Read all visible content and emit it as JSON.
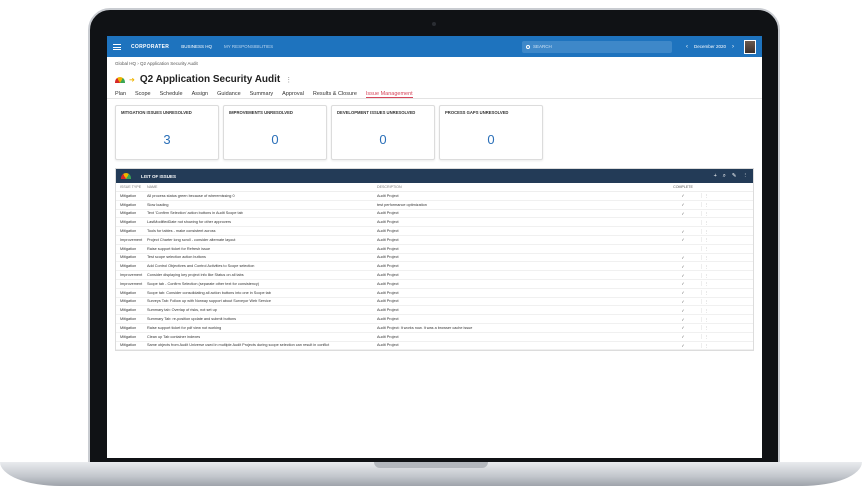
{
  "topbar": {
    "brand": "CORPORATER",
    "nav": [
      "BUSINESS HQ",
      "MY RESPONSIBILITIES"
    ],
    "search_placeholder": "SEARCH",
    "period": "December 2020"
  },
  "breadcrumb": "Global HQ  ›  Q2 Application Security Audit",
  "page_title": "Q2 Application Security Audit",
  "tabs": [
    "Plan",
    "Scope",
    "Schedule",
    "Assign",
    "Guidance",
    "Summary",
    "Approval",
    "Results & Closure",
    "Issue Management"
  ],
  "active_tab": "Issue Management",
  "cards": [
    {
      "label": "MITIGATION ISSUES UNRESOLVED",
      "value": "3"
    },
    {
      "label": "IMPROVEMENTS UNRESOLVED",
      "value": "0"
    },
    {
      "label": "DEVELOPMENT ISSUES UNRESOLVED",
      "value": "0"
    },
    {
      "label": "PROCESS GAPS UNRESOLVED",
      "value": "0"
    }
  ],
  "list": {
    "title": "LIST OF ISSUES",
    "columns": {
      "type": "ISSUE TYPE",
      "name": "NAME",
      "description": "DESCRIPTION",
      "complete": "COMPLETE"
    },
    "rows": [
      {
        "type": "Mitigation",
        "name": "All process status green because of wheremissing 0",
        "description": "Audit Project",
        "complete": true
      },
      {
        "type": "Mitigation",
        "name": "Slow loading",
        "description": "test performance optimization",
        "complete": true
      },
      {
        "type": "Mitigation",
        "name": "Text 'Confirm Selection' action buttons in Audit Scope tab",
        "description": "Audit Project",
        "complete": true
      },
      {
        "type": "Mitigation",
        "name": "LastModifiedDate not showing for other approvers",
        "description": "Audit Project",
        "complete": false
      },
      {
        "type": "Mitigation",
        "name": "Tools for tables - make consistent across",
        "description": "Audit Project",
        "complete": true
      },
      {
        "type": "Improvement",
        "name": "Project Charter long scroll - consider alternate layout",
        "description": "Audit Project",
        "complete": true
      },
      {
        "type": "Mitigation",
        "name": "Raise support ticket for Refresh issue",
        "description": "Audit Project",
        "complete": false
      },
      {
        "type": "Mitigation",
        "name": "Test scope selection action buttons",
        "description": "Audit Project",
        "complete": true
      },
      {
        "type": "Mitigation",
        "name": "Add Control Objectives and Control Activities to Scope selection",
        "description": "Audit Project",
        "complete": true
      },
      {
        "type": "Improvement",
        "name": "Consider displaying key project info like Status on all tabs",
        "description": "Audit Project",
        "complete": true
      },
      {
        "type": "Improvement",
        "name": "Scope tab - Confirm Selection (separate other text for consistency)",
        "description": "Audit Project",
        "complete": true
      },
      {
        "type": "Mitigation",
        "name": "Scope tab: Consider consolidating all action buttons into one in Scope tab",
        "description": "Audit Project",
        "complete": true
      },
      {
        "type": "Mitigation",
        "name": "Surveys Tab: Follow up with Norway support about Surveyor Web Service",
        "description": "Audit Project",
        "complete": true
      },
      {
        "type": "Mitigation",
        "name": "Summary tab: Overlap of risks, not set up",
        "description": "Audit Project",
        "complete": true
      },
      {
        "type": "Mitigation",
        "name": "Summary Tab: re-position update and submit buttons",
        "description": "Audit Project",
        "complete": true
      },
      {
        "type": "Mitigation",
        "name": "Raise support ticket for pdf view not working",
        "description": "Audit Project: It works now. It was a browser cache issue",
        "complete": true
      },
      {
        "type": "Mitigation",
        "name": "Clean up Tab container indexes",
        "description": "Audit Project",
        "complete": true
      },
      {
        "type": "Mitigation",
        "name": "Same objects from Audit Universe used in multiple Audit Projects during scope selection can result in conflict",
        "description": "Audit Project",
        "complete": true
      }
    ]
  }
}
